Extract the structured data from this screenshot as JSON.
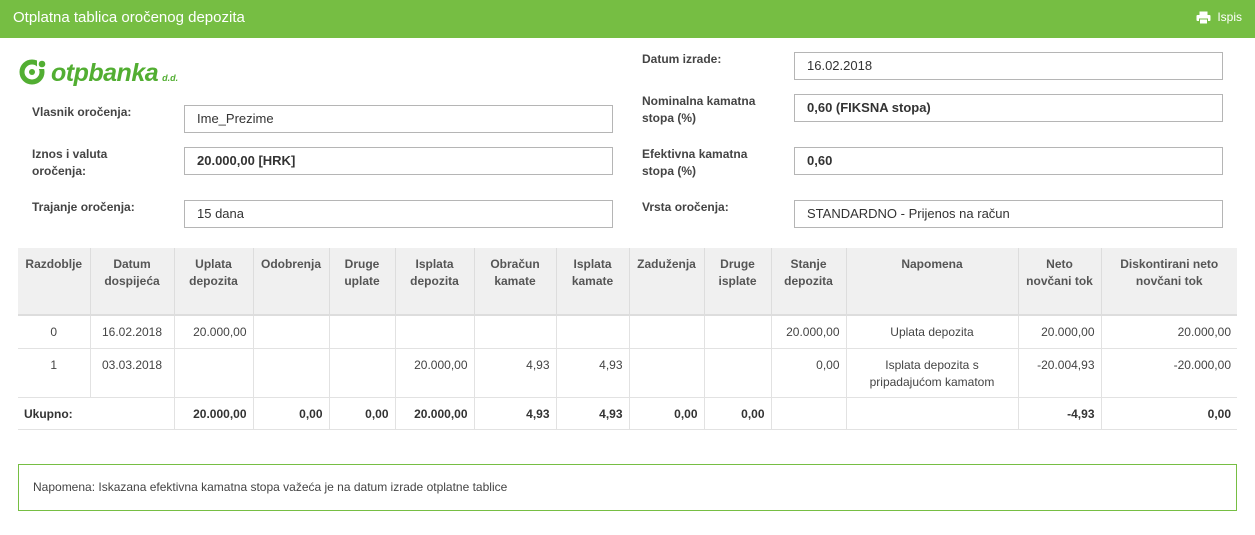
{
  "header": {
    "title": "Otplatna tablica oročenog depozita",
    "print_label": "Ispis"
  },
  "logo": {
    "word": "otpbanka",
    "suffix": "d.d."
  },
  "form": {
    "owner_label": "Vlasnik oročenja:",
    "owner_value": "Ime_Prezime",
    "amount_label": "Iznos i valuta oročenja:",
    "amount_value": "20.000,00 [HRK]",
    "duration_label": "Trajanje oročenja:",
    "duration_value": "15 dana",
    "date_label": "Datum izrade:",
    "date_value": "16.02.2018",
    "nominal_label": "Nominalna kamatna stopa (%)",
    "nominal_value": "0,60  (FIKSNA stopa)",
    "effective_label": "Efektivna kamatna stopa (%)",
    "effective_value": "0,60",
    "type_label": "Vrsta oročenja:",
    "type_value": "STANDARDNO - Prijenos na račun"
  },
  "table": {
    "headers": [
      "Razdoblje",
      "Datum dospijeća",
      "Uplata depozita",
      "Odobrenja",
      "Druge uplate",
      "Isplata depozita",
      "Obračun kamate",
      "Isplata kamate",
      "Zaduženja",
      "Druge isplate",
      "Stanje depozita",
      "Napomena",
      "Neto novčani tok",
      "Diskontirani neto novčani tok"
    ],
    "rows": [
      [
        "0",
        "16.02.2018",
        "20.000,00",
        "",
        "",
        "",
        "",
        "",
        "",
        "",
        "20.000,00",
        "Uplata depozita",
        "20.000,00",
        "20.000,00"
      ],
      [
        "1",
        "03.03.2018",
        "",
        "",
        "",
        "20.000,00",
        "4,93",
        "4,93",
        "",
        "",
        "0,00",
        "Isplata depozita s pripadajućom kamatom",
        "-20.004,93",
        "-20.000,00"
      ]
    ],
    "total": [
      "Ukupno:",
      "20.000,00",
      "0,00",
      "0,00",
      "20.000,00",
      "4,93",
      "4,93",
      "0,00",
      "0,00",
      "",
      "",
      "-4,93",
      "0,00"
    ]
  },
  "note": "Napomena: Iskazana efektivna kamatna stopa važeća je na datum izrade otplatne tablice",
  "colors": {
    "accent": "#76be43",
    "logo_green": "#52ae32"
  },
  "icons": {
    "print": "printer-icon",
    "logo": "otp-logo-icon"
  }
}
